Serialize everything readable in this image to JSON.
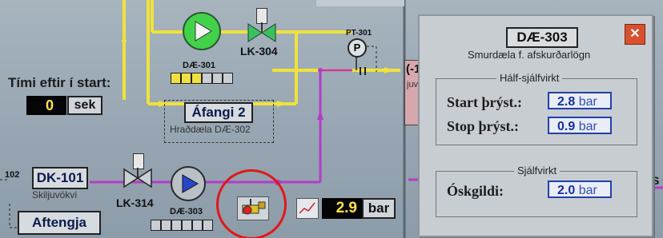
{
  "start": {
    "label": "Tími eftir í start:",
    "value": "0",
    "unit": "sek"
  },
  "pumps": {
    "dae301": "DÆ-301",
    "dae303": "DÆ-303"
  },
  "valves": {
    "lk304": "LK-304",
    "lk314": "LK-314"
  },
  "sensor": {
    "pt301": "PT-301",
    "pt_symbol": "P"
  },
  "step": {
    "label": "Áfangi 2",
    "sub": "Hraðdæla DÆ-302"
  },
  "dk101": {
    "label": "DK-101",
    "sub": "Skiljuvökvi",
    "left_num": "102"
  },
  "aftengja_label": "Aftengja",
  "pressure": {
    "value": "2.9",
    "unit": "bar"
  },
  "partial_left": "(-1",
  "partial_left_sub": "juv",
  "popup": {
    "title": "DÆ-303",
    "subtitle": "Smurdæla f. afskurðarlögn",
    "group1": "Hálf-sjálfvirkt",
    "start_label": "Start þrýst.:",
    "start_value": "2.8",
    "stop_label": "Stop þrýst.:",
    "stop_value": "0.9",
    "group2": "Sjálfvirkt",
    "desired_label": "Óskgildi:",
    "desired_value": "2.0",
    "unit": "bar",
    "close_glyph": "✕"
  },
  "edge_right": "S",
  "colors": {
    "yellow_pipe": "#f0e23a",
    "purple_pipe": "#b43cc6",
    "pump_green": "#42d24a",
    "pump_blue": "#2846c8",
    "annotation_red": "#e01818",
    "value_blue": "#1530a0"
  }
}
